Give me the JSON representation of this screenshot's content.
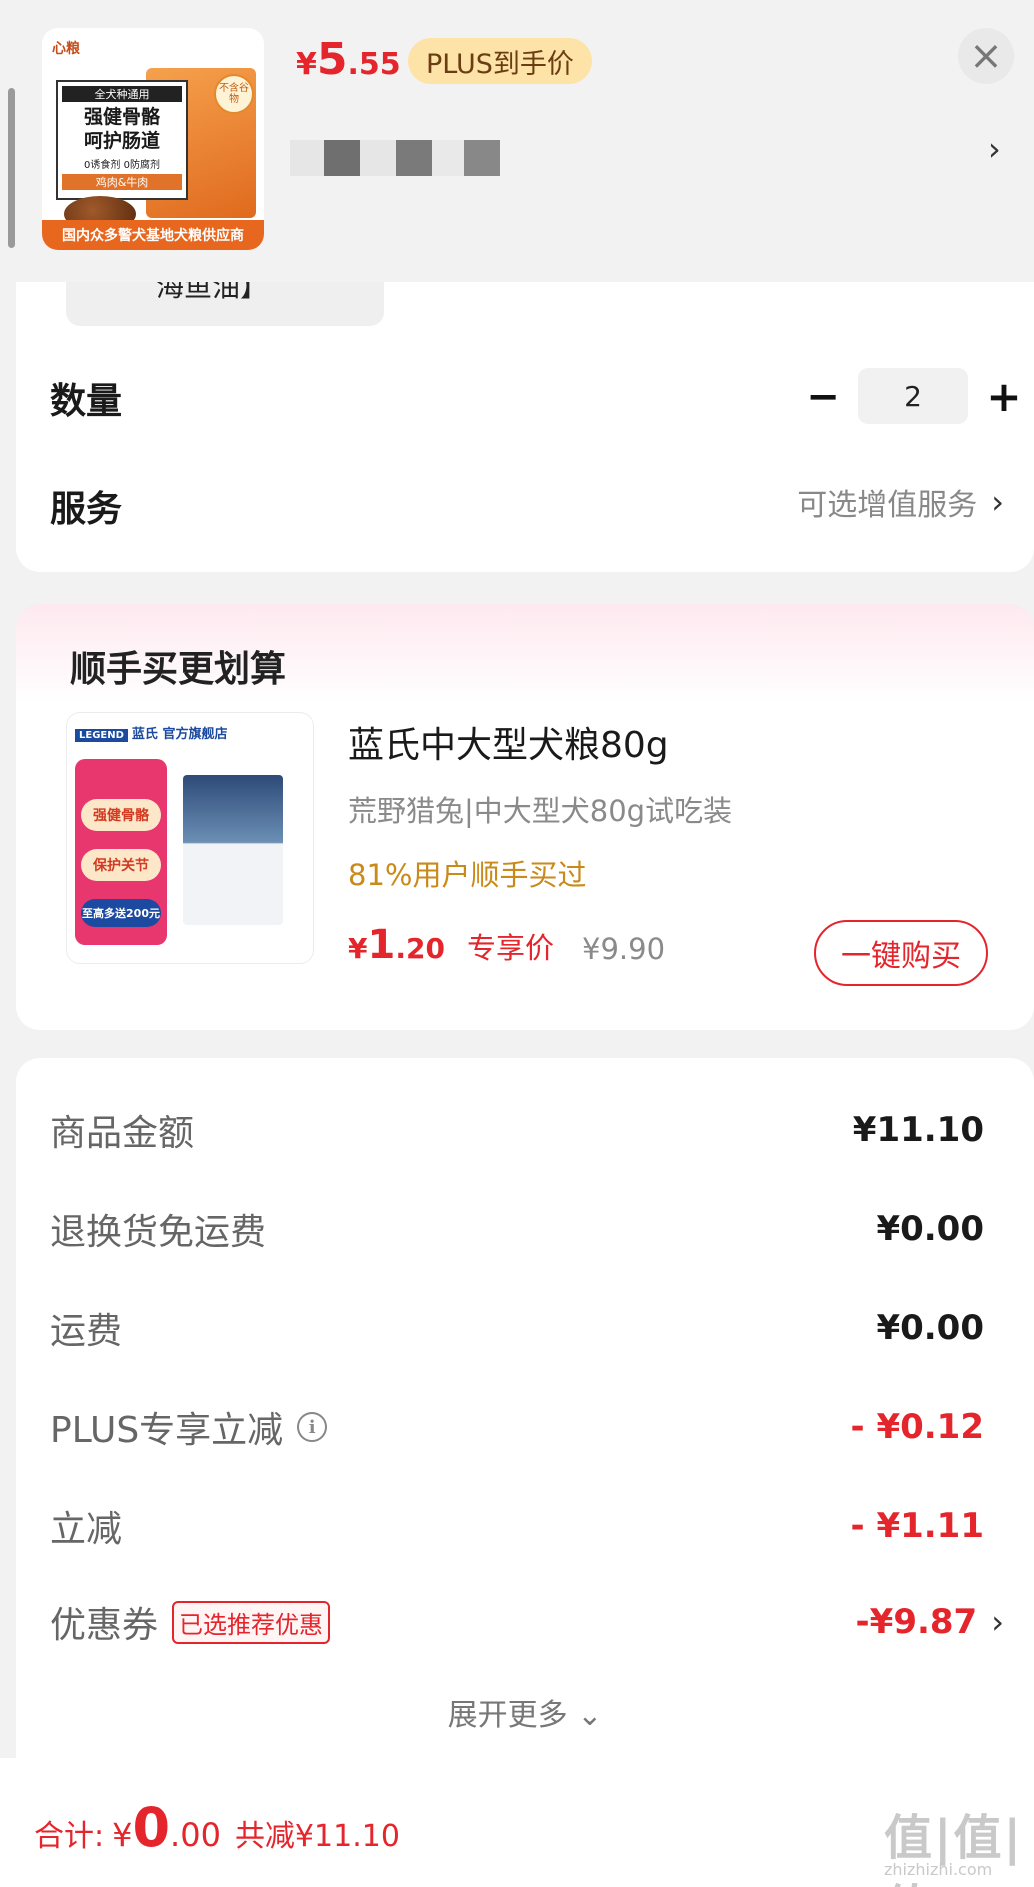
{
  "header": {
    "thumbnail": {
      "brand": "心粮",
      "box_line1": "全犬种通用",
      "box_line2a": "强健骨骼",
      "box_line2b": "呵护肠道",
      "box_line3": "0诱食剂 0防腐剂",
      "box_line4": "鸡肉&牛肉",
      "badge": "不含谷物",
      "footer": "国内众多警犬基地犬粮供应商"
    },
    "price_currency": "¥",
    "price_int": "5",
    "price_dec": ".55",
    "plus_label": "PLUS到手价",
    "close_icon": "×",
    "chevron_icon": "›"
  },
  "spec_chip_text": "海鱼油】",
  "quantity": {
    "label": "数量",
    "minus": "−",
    "value": "2",
    "plus": "+"
  },
  "service": {
    "label": "服务",
    "value": "可选增值服务",
    "chevron": "›"
  },
  "bundle": {
    "title": "顺手买更划算",
    "image": {
      "store_logo": "LEGEND",
      "store_name": "蓝氏 官方旗舰店",
      "tags": [
        "强健骨骼",
        "保护关节",
        "至高多送200元"
      ]
    },
    "product_name": "蓝氏中大型犬粮80g",
    "subtitle": "荒野猎兔|中大型犬80g试吃装",
    "bought": "81%用户顺手买过",
    "price_currency": "¥",
    "price_int": "1",
    "price_dec": ".20",
    "price_tag": "专享价",
    "original_price": "¥9.90",
    "buy_button": "一键购买"
  },
  "breakdown": {
    "rows": [
      {
        "label": "商品金额",
        "value": "¥11.10"
      },
      {
        "label": "退换货免运费",
        "value": "¥0.00"
      },
      {
        "label": "运费",
        "value": "¥0.00"
      },
      {
        "label": "PLUS专享立减",
        "value": "- ¥0.12"
      },
      {
        "label": "立减",
        "value": "- ¥1.11"
      },
      {
        "label": "优惠券",
        "value": "-¥9.87",
        "tag": "已选推荐优惠"
      }
    ],
    "expand_more": "展开更多 ⌄"
  },
  "total": {
    "label": "合计:",
    "currency": "¥",
    "int": "0",
    "dec": ".00",
    "saved": "共减¥11.10"
  },
  "watermark": {
    "main": "值|值|值",
    "sub": "zhizhizhi.com"
  },
  "colors": {
    "accent_red": "#e4252c",
    "plus_gold_bg": "#fde3a7",
    "bought_orange": "#c98a1a",
    "page_bg": "#f2f2f2"
  }
}
